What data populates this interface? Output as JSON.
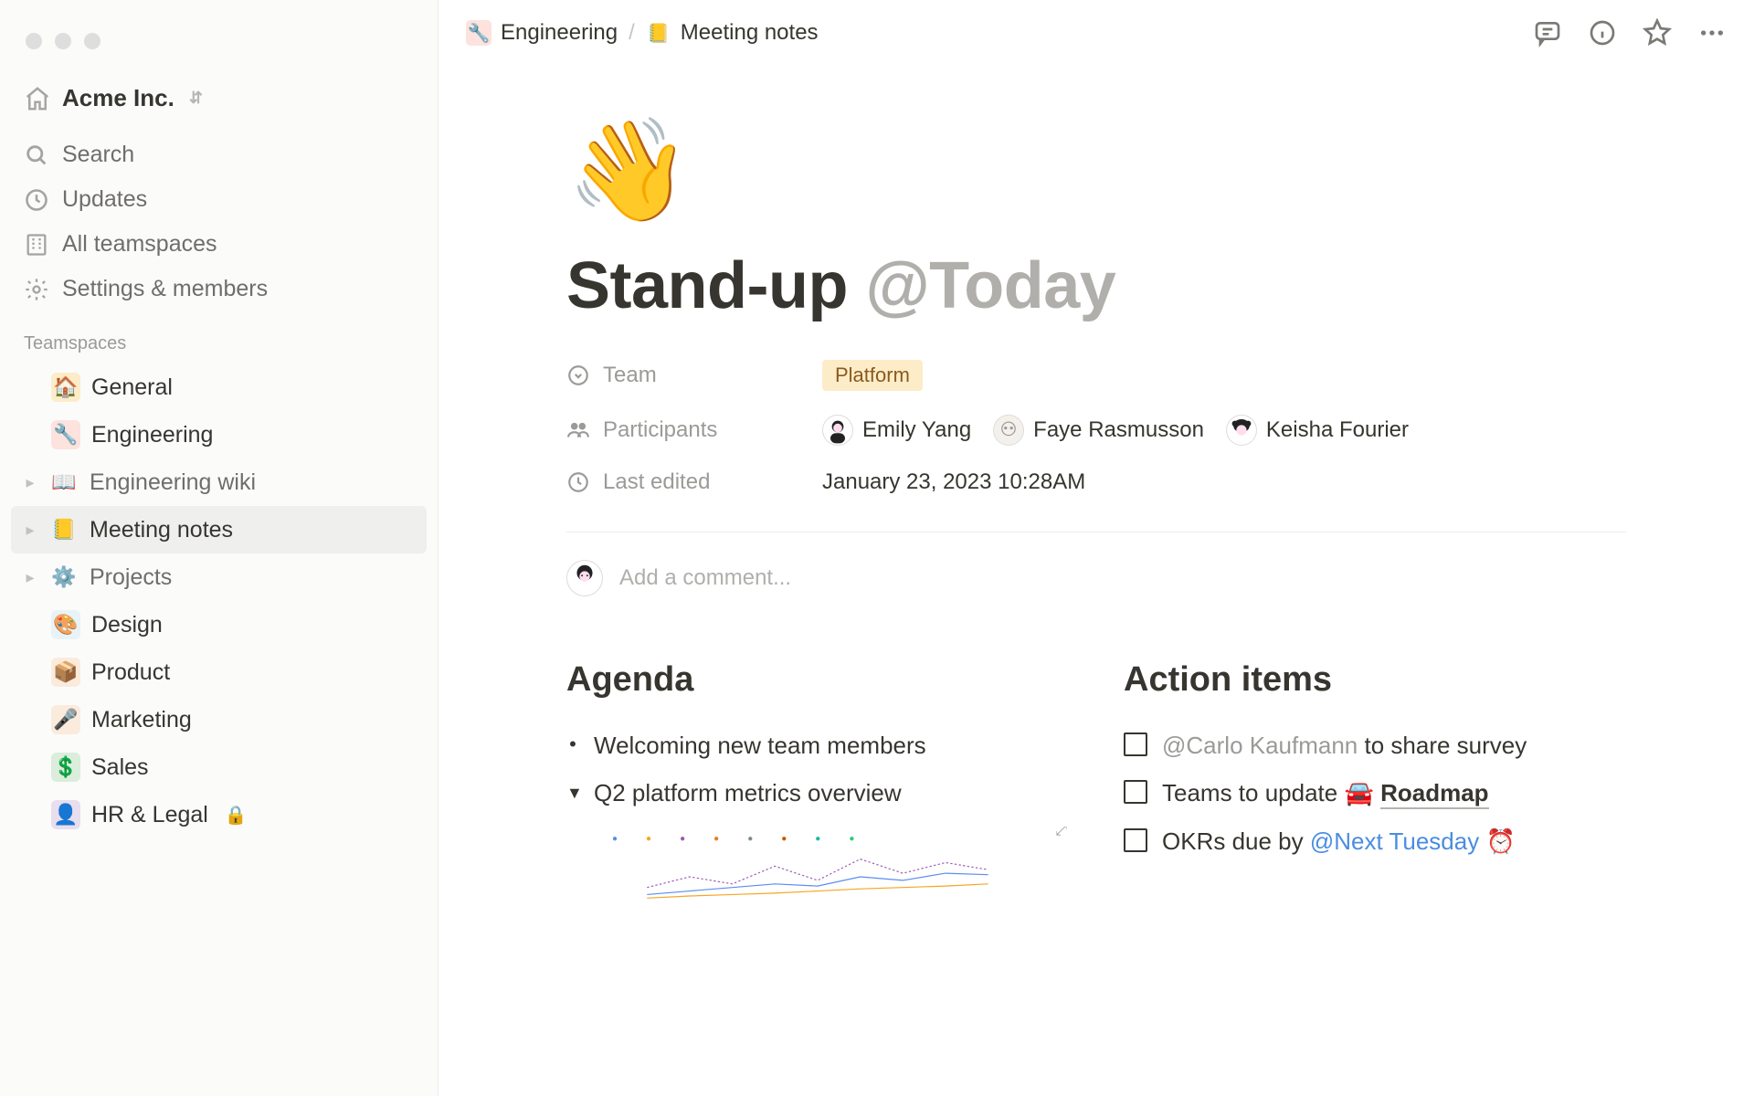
{
  "workspace": {
    "name": "Acme Inc."
  },
  "sidebar": {
    "nav": [
      {
        "label": "Search"
      },
      {
        "label": "Updates"
      },
      {
        "label": "All teamspaces"
      },
      {
        "label": "Settings & members"
      }
    ],
    "section_label": "Teamspaces",
    "teamspaces": [
      {
        "label": "General"
      },
      {
        "label": "Engineering"
      },
      {
        "label": "Engineering wiki"
      },
      {
        "label": "Meeting notes"
      },
      {
        "label": "Projects"
      },
      {
        "label": "Design"
      },
      {
        "label": "Product"
      },
      {
        "label": "Marketing"
      },
      {
        "label": "Sales"
      },
      {
        "label": "HR & Legal"
      }
    ]
  },
  "breadcrumb": {
    "items": [
      {
        "label": "Engineering"
      },
      {
        "label": "Meeting notes"
      }
    ]
  },
  "page": {
    "emoji": "👋",
    "title_main": "Stand-up ",
    "title_mention": "@Today",
    "properties": {
      "team": {
        "label": "Team",
        "value": "Platform"
      },
      "participants": {
        "label": "Participants",
        "people": [
          "Emily Yang",
          "Faye Rasmusson",
          "Keisha Fourier"
        ]
      },
      "last_edited": {
        "label": "Last edited",
        "value": "January 23, 2023 10:28AM"
      }
    },
    "comment_placeholder": "Add a comment...",
    "agenda": {
      "heading": "Agenda",
      "items": [
        {
          "type": "bullet",
          "text": "Welcoming new team members"
        },
        {
          "type": "toggle",
          "text": "Q2 platform metrics overview"
        }
      ]
    },
    "action_items": {
      "heading": "Action items",
      "items": [
        {
          "mention": "@Carlo Kaufmann",
          "rest": " to share survey"
        },
        {
          "pre": "Teams to update ",
          "link_emoji": "🚘",
          "link": "Roadmap"
        },
        {
          "pre": "OKRs due by ",
          "date_mention": "@Next Tuesday",
          "reminder": "⏰"
        }
      ]
    }
  }
}
